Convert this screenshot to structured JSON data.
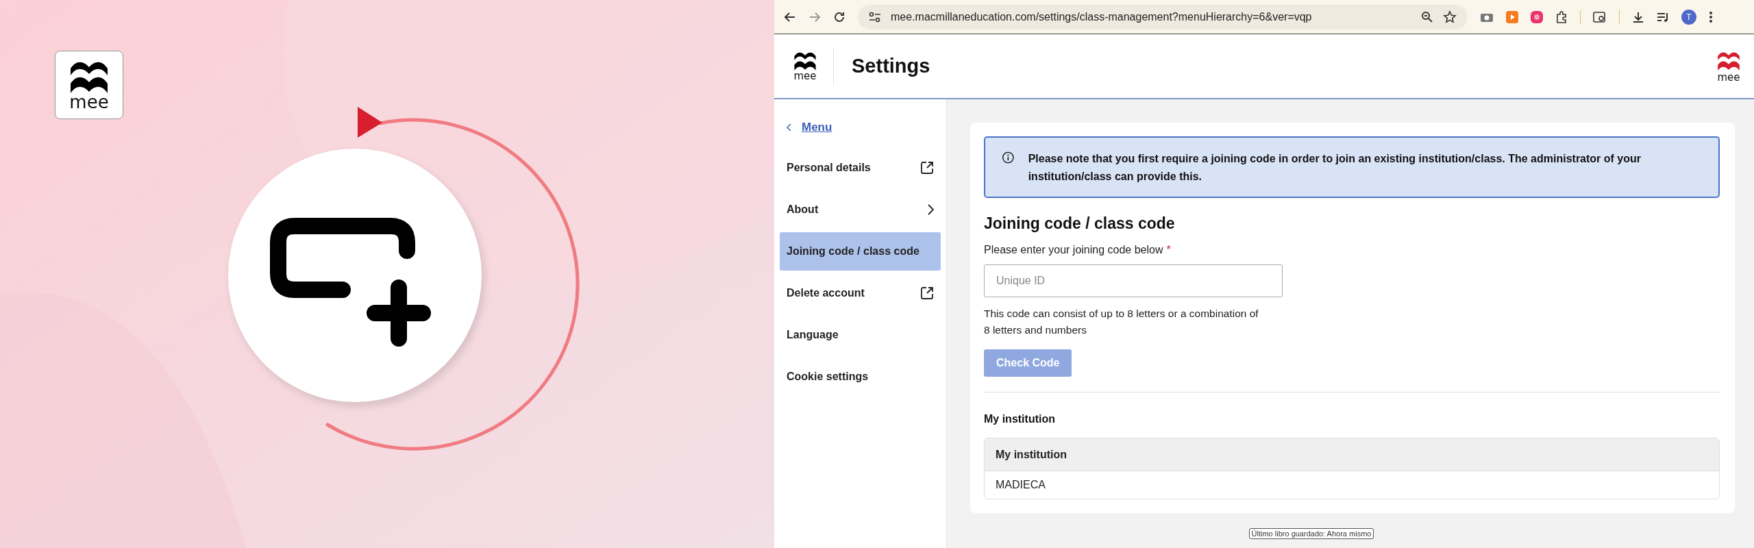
{
  "hero": {
    "logo_text": "mee"
  },
  "browser": {
    "url": "mee.macmillaneducation.com/settings/class-management?menuHierarchy=6&ver=vqp",
    "profile_initial": "T"
  },
  "header": {
    "logo_text": "mee",
    "title": "Settings",
    "brand_logo_text": "mee"
  },
  "sidebar": {
    "back_link": "Menu",
    "items": [
      {
        "label": "Personal details",
        "kind": "external",
        "selected": false
      },
      {
        "label": "About",
        "kind": "submenu",
        "selected": false
      },
      {
        "label": "Joining code / class code",
        "kind": "plain",
        "selected": true
      },
      {
        "label": "Delete account",
        "kind": "external",
        "selected": false
      },
      {
        "label": "Language",
        "kind": "plain",
        "selected": false
      },
      {
        "label": "Cookie settings",
        "kind": "plain",
        "selected": false
      }
    ]
  },
  "notice": "Please note that you first require a joining code in order to join an existing institution/class. The administrator of your institution/class can provide this.",
  "form": {
    "heading": "Joining code / class code",
    "label": "Please enter your joining code below",
    "required_mark": "*",
    "placeholder": "Unique ID",
    "help": "This code can consist of up to 8 letters or a combination of 8 letters and numbers",
    "button": {
      "label": "Check Code",
      "disabled": true
    }
  },
  "institution": {
    "heading": "My institution",
    "table": {
      "columns": [
        "My institution"
      ],
      "rows": [
        [
          "MADIECA"
        ]
      ]
    }
  },
  "status_tooltip": "Último libro guardado: Ahora mismo"
}
